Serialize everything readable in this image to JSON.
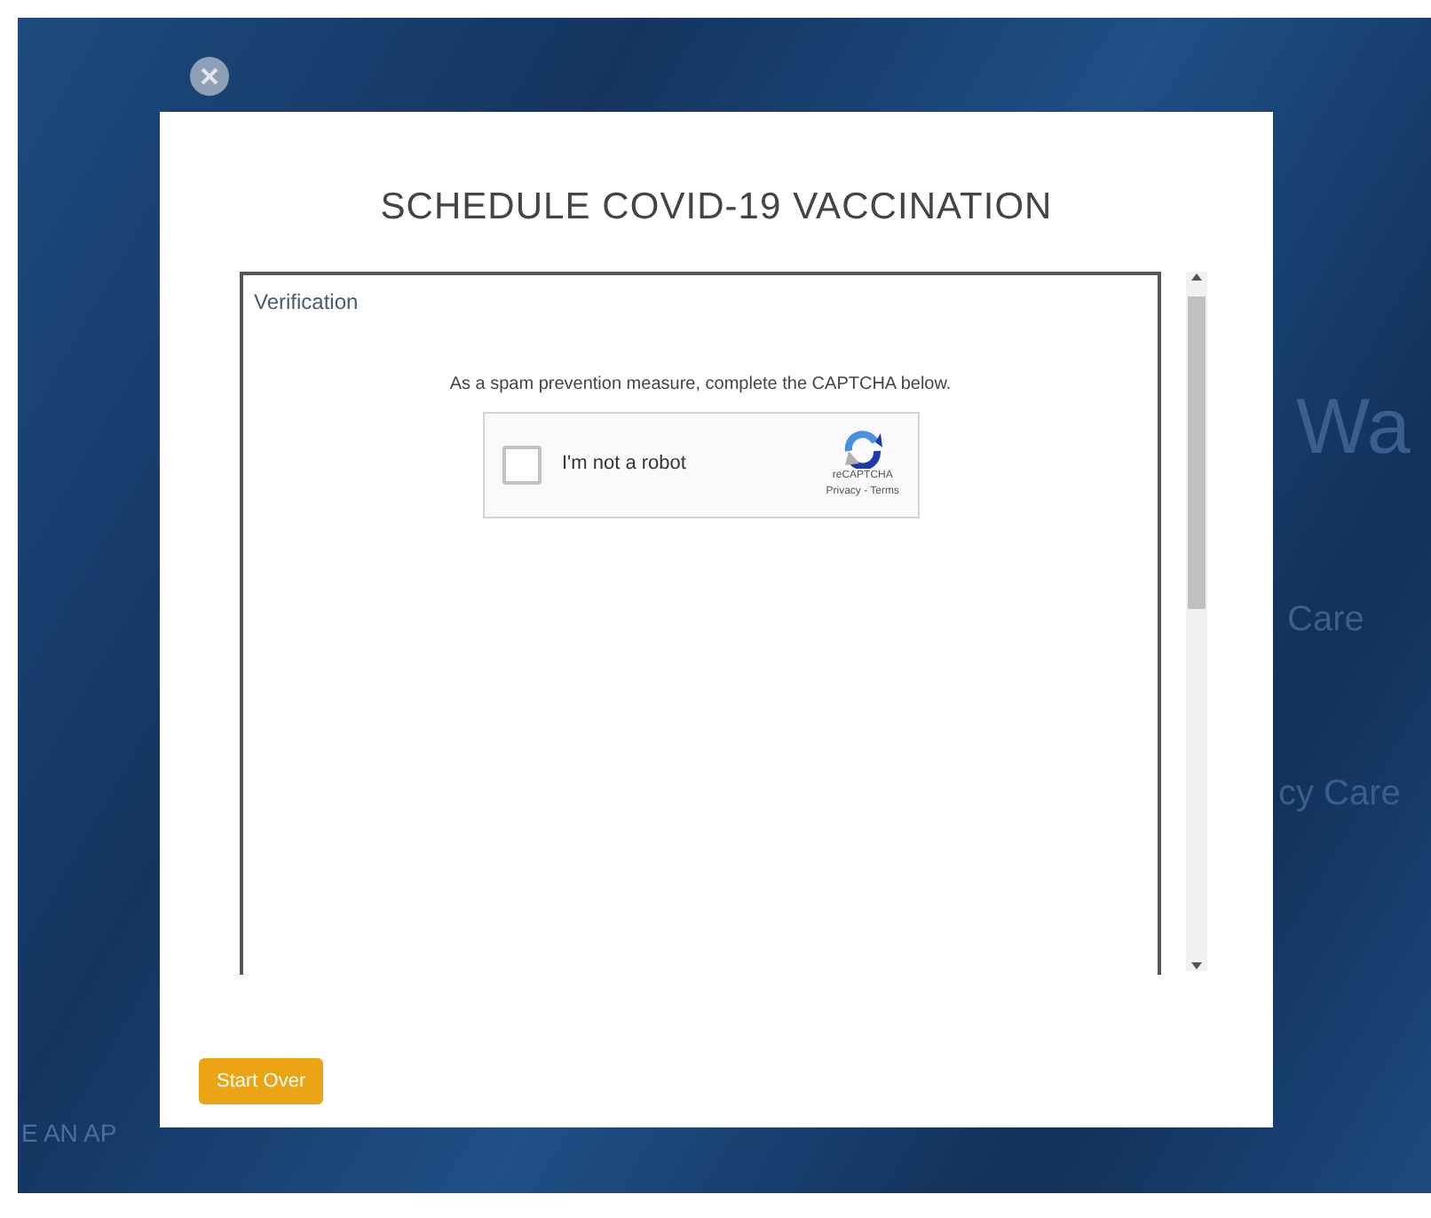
{
  "background": {
    "fragments": [
      {
        "text": "Wa",
        "kind": "large"
      },
      {
        "text": "Care",
        "kind": "medium"
      },
      {
        "text": "cy Care",
        "kind": "medium"
      },
      {
        "text": "E AN AP",
        "kind": "small"
      }
    ]
  },
  "modal": {
    "title": "SCHEDULE COVID-19 VACCINATION",
    "section_title": "Verification",
    "instruction": "As a spam prevention measure, complete the CAPTCHA below.",
    "captcha": {
      "label": "I'm not a robot",
      "checked": false,
      "brand": "reCAPTCHA",
      "links": "Privacy - Terms"
    },
    "buttons": [
      {
        "label": "Start Over"
      }
    ]
  }
}
